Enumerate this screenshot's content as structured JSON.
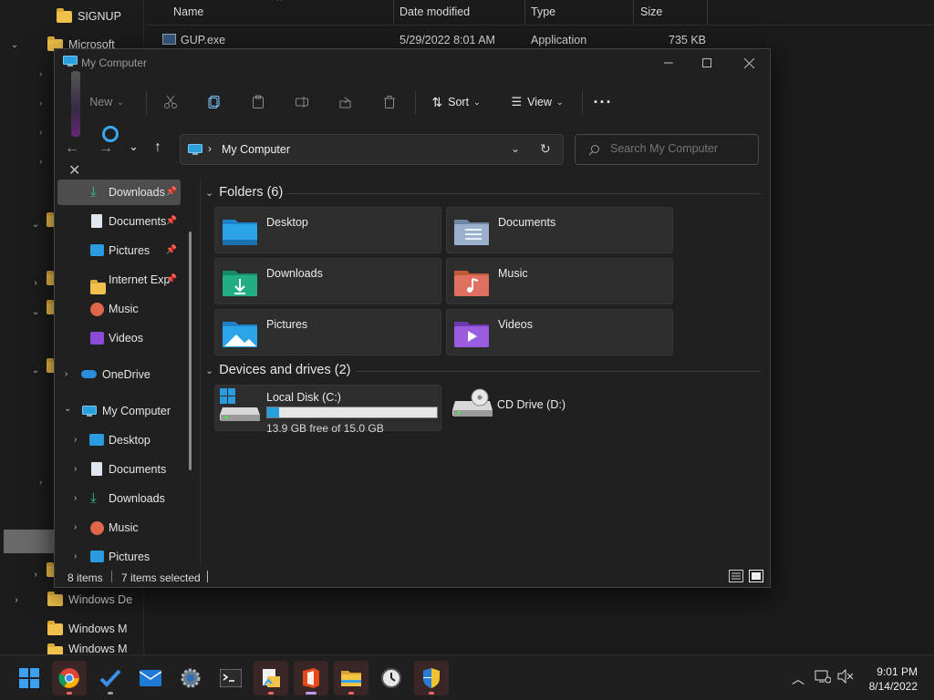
{
  "background_explorer": {
    "nav_items": [
      "SIGNUP",
      "Microsoft",
      "Windows De",
      "Windows M",
      "Windows M"
    ],
    "columns": [
      "Name",
      "Date modified",
      "Type",
      "Size"
    ],
    "row": {
      "name": "GUP.exe",
      "date": "5/29/2022 8:01 AM",
      "type": "Application",
      "size": "735 KB"
    }
  },
  "window": {
    "title": "My Computer",
    "toolbar": {
      "new_label": "New",
      "sort_label": "Sort",
      "view_label": "View"
    },
    "address": {
      "path_item": "My Computer"
    },
    "search": {
      "placeholder": "Search My Computer"
    },
    "nav": {
      "quick_access": [
        {
          "label": "Downloads",
          "icon": "download-icon",
          "pinned": true,
          "selected": true
        },
        {
          "label": "Documents",
          "icon": "document-icon",
          "pinned": true
        },
        {
          "label": "Pictures",
          "icon": "picture-icon",
          "pinned": true
        },
        {
          "label": "Internet Exp",
          "icon": "folder-icon",
          "pinned": true
        },
        {
          "label": "Music",
          "icon": "music-icon"
        },
        {
          "label": "Videos",
          "icon": "video-icon"
        }
      ],
      "onedrive": "OneDrive",
      "my_computer": "My Computer",
      "my_computer_children": [
        "Desktop",
        "Documents",
        "Downloads",
        "Music",
        "Pictures"
      ]
    },
    "folders_header": "Folders (6)",
    "folders": [
      {
        "name": "Desktop",
        "color": "#2b9be0"
      },
      {
        "name": "Documents",
        "color": "#8aa4c2"
      },
      {
        "name": "Downloads",
        "color": "#1fa37a"
      },
      {
        "name": "Music",
        "color": "#e0664b"
      },
      {
        "name": "Pictures",
        "color": "#2b9be0"
      },
      {
        "name": "Videos",
        "color": "#8a4bd6"
      }
    ],
    "drives_header": "Devices and drives (2)",
    "drives": [
      {
        "name": "Local Disk (C:)",
        "free_text": "13.9 GB free of 15.0 GB",
        "used_fraction": 0.07
      },
      {
        "name": "CD Drive (D:)"
      }
    ],
    "status": {
      "items": "8 items",
      "selected": "7 items selected"
    }
  },
  "taskbar": {
    "apps": [
      "start-icon",
      "chrome-icon",
      "todo-icon",
      "mail-icon",
      "settings-icon",
      "terminal-icon",
      "file-folder-app-icon",
      "office-icon",
      "file-explorer-icon",
      "clock-app-icon",
      "security-icon"
    ],
    "time": "9:01 PM",
    "date": "8/14/2022"
  },
  "colors": {
    "accent": "#0078d4",
    "window_bg": "#202020",
    "tile_bg": "#2d2d2d"
  }
}
